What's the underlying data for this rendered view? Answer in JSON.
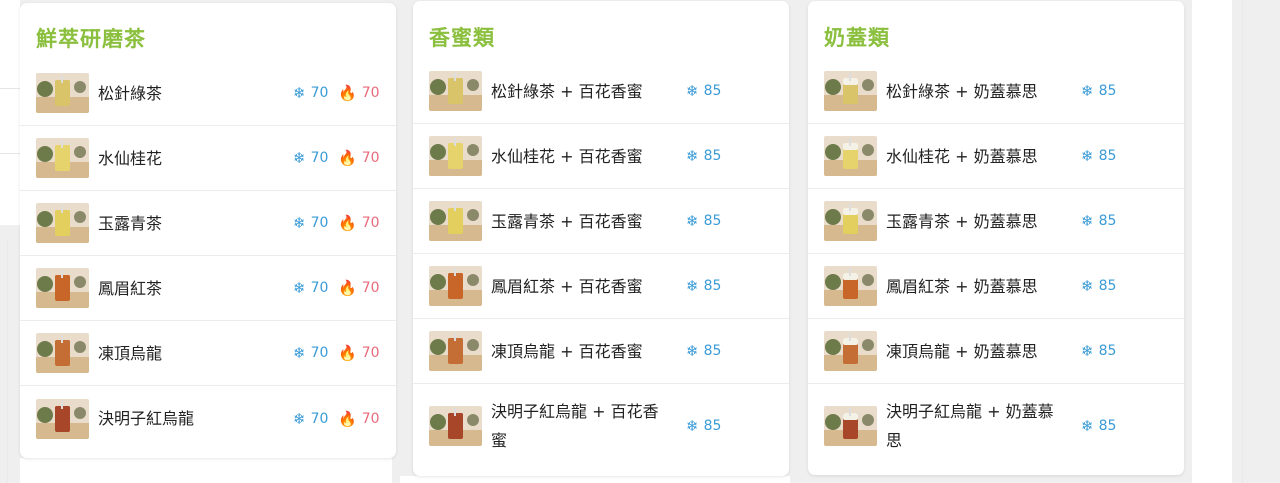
{
  "colors": {
    "title": "#8bbf3e",
    "cold": "#3a9bd6",
    "hot": "#e86a7a"
  },
  "cards": [
    {
      "title": "鮮萃研磨茶",
      "items": [
        {
          "name": "松針綠茶",
          "cold_price": "70",
          "hot_price": "70"
        },
        {
          "name": "水仙桂花",
          "cold_price": "70",
          "hot_price": "70"
        },
        {
          "name": "玉露青茶",
          "cold_price": "70",
          "hot_price": "70"
        },
        {
          "name": "鳳眉紅茶",
          "cold_price": "70",
          "hot_price": "70"
        },
        {
          "name": "凍頂烏龍",
          "cold_price": "70",
          "hot_price": "70"
        },
        {
          "name": "決明子紅烏龍",
          "cold_price": "70",
          "hot_price": "70"
        }
      ]
    },
    {
      "title": "香蜜類",
      "items": [
        {
          "name": "松針綠茶 + 百花香蜜",
          "cold_price": "85"
        },
        {
          "name": "水仙桂花 + 百花香蜜",
          "cold_price": "85"
        },
        {
          "name": "玉露青茶 + 百花香蜜",
          "cold_price": "85"
        },
        {
          "name": "鳳眉紅茶 + 百花香蜜",
          "cold_price": "85"
        },
        {
          "name": "凍頂烏龍 + 百花香蜜",
          "cold_price": "85"
        },
        {
          "name": "決明子紅烏龍 + 百花香蜜",
          "cold_price": "85"
        }
      ]
    },
    {
      "title": "奶蓋類",
      "items": [
        {
          "name": "松針綠茶 + 奶蓋慕思",
          "cold_price": "85"
        },
        {
          "name": "水仙桂花 + 奶蓋慕思",
          "cold_price": "85"
        },
        {
          "name": "玉露青茶 + 奶蓋慕思",
          "cold_price": "85"
        },
        {
          "name": "鳳眉紅茶 + 奶蓋慕思",
          "cold_price": "85"
        },
        {
          "name": "凍頂烏龍 + 奶蓋慕思",
          "cold_price": "85"
        },
        {
          "name": "決明子紅烏龍 + 奶蓋慕思",
          "cold_price": "85"
        }
      ]
    }
  ],
  "icons": {
    "cold": "snowflake-icon",
    "hot": "flame-icon"
  }
}
